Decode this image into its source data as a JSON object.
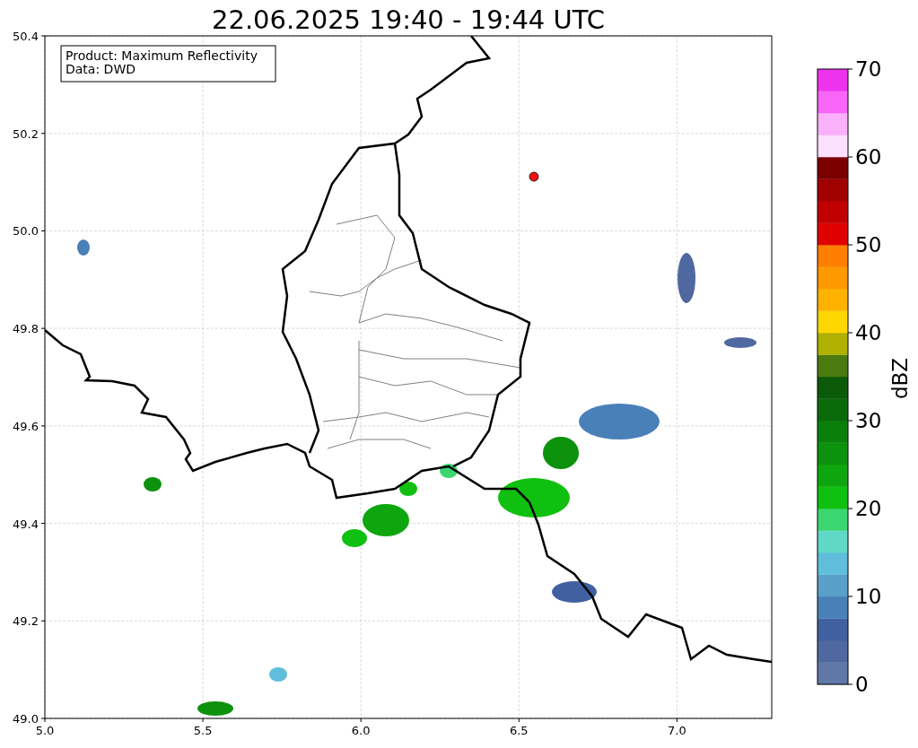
{
  "title": "22.06.2025 19:40 - 19:44 UTC",
  "info_box": [
    "Product: Maximum Reflectivity",
    "Data: DWD"
  ],
  "x_ticks": [
    "5.0",
    "5.5",
    "6.0",
    "6.5",
    "7.0"
  ],
  "y_ticks": [
    "50.4",
    "50.2",
    "50.0",
    "49.8",
    "49.6",
    "49.4",
    "49.2",
    "49.0"
  ],
  "colorbar": {
    "label": "dBZ",
    "ticks": [
      "70",
      "60",
      "50",
      "40",
      "30",
      "20",
      "10",
      "0"
    ],
    "segments": [
      {
        "color": "#6078a8"
      },
      {
        "color": "#5068a0"
      },
      {
        "color": "#4060a0"
      },
      {
        "color": "#4a80b8"
      },
      {
        "color": "#58a0c8"
      },
      {
        "color": "#60bedc"
      },
      {
        "color": "#60d8c8"
      },
      {
        "color": "#3cd670"
      },
      {
        "color": "#10c010"
      },
      {
        "color": "#0ea60e"
      },
      {
        "color": "#0c920c"
      },
      {
        "color": "#0a800a"
      },
      {
        "color": "#0a6a0a"
      },
      {
        "color": "#0a5a0a"
      },
      {
        "color": "#4a7a10"
      },
      {
        "color": "#b0b000"
      },
      {
        "color": "#ffd700"
      },
      {
        "color": "#ffb300"
      },
      {
        "color": "#ff9900"
      },
      {
        "color": "#ff7f00"
      },
      {
        "color": "#e00000"
      },
      {
        "color": "#c00000"
      },
      {
        "color": "#a00000"
      },
      {
        "color": "#7a0000"
      },
      {
        "color": "#fde0fd"
      },
      {
        "color": "#fbb0fb"
      },
      {
        "color": "#f766f7"
      },
      {
        "color": "#ee33ee"
      }
    ]
  }
}
